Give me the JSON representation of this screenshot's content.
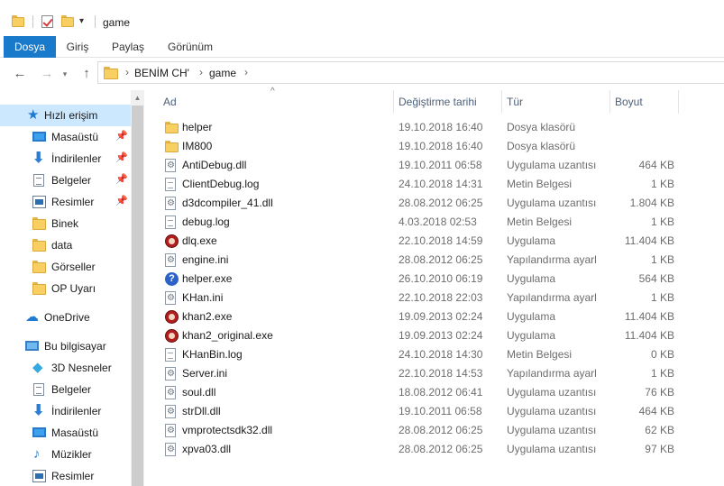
{
  "window": {
    "title": "game"
  },
  "quick_access_toolbar": {
    "icons": [
      "folder-icon",
      "properties-check-icon",
      "new-folder-icon",
      "customize-dropdown-icon"
    ]
  },
  "ribbon": {
    "tabs": [
      {
        "label": "Dosya",
        "active": true
      },
      {
        "label": "Giriş",
        "active": false
      },
      {
        "label": "Paylaş",
        "active": false
      },
      {
        "label": "Görünüm",
        "active": false
      }
    ],
    "accent_color": "#1979ca"
  },
  "address": {
    "path": [
      "BENİM CH'",
      "game"
    ]
  },
  "navigation": {
    "quick_access": {
      "label": "Hızlı erişim"
    },
    "pinned": [
      {
        "label": "Masaüstü"
      },
      {
        "label": "İndirilenler"
      },
      {
        "label": "Belgeler"
      },
      {
        "label": "Resimler"
      }
    ],
    "folders": [
      {
        "label": "Binek"
      },
      {
        "label": "data"
      },
      {
        "label": "Görseller"
      },
      {
        "label": "OP Uyarı"
      }
    ],
    "onedrive": {
      "label": "OneDrive"
    },
    "this_pc": {
      "label": "Bu bilgisayar"
    },
    "pc_items": [
      {
        "label": "3D Nesneler"
      },
      {
        "label": "Belgeler"
      },
      {
        "label": "İndirilenler"
      },
      {
        "label": "Masaüstü"
      },
      {
        "label": "Müzikler"
      },
      {
        "label": "Resimler"
      }
    ],
    "selection_color": "#cce8ff"
  },
  "file_list": {
    "columns": {
      "name": "Ad",
      "date": "Değiştirme tarihi",
      "type": "Tür",
      "size": "Boyut"
    },
    "rows": [
      {
        "name": "helper",
        "date": "19.10.2018 16:40",
        "type": "Dosya klasörü",
        "size": "",
        "icon": "folder"
      },
      {
        "name": "IM800",
        "date": "19.10.2018 16:40",
        "type": "Dosya klasörü",
        "size": "",
        "icon": "folder"
      },
      {
        "name": "AntiDebug.dll",
        "date": "19.10.2011 06:58",
        "type": "Uygulama uzantısı",
        "size": "464 KB",
        "icon": "gear"
      },
      {
        "name": "ClientDebug.log",
        "date": "24.10.2018 14:31",
        "type": "Metin Belgesi",
        "size": "1 KB",
        "icon": "file"
      },
      {
        "name": "d3dcompiler_41.dll",
        "date": "28.08.2012 06:25",
        "type": "Uygulama uzantısı",
        "size": "1.804 KB",
        "icon": "gear"
      },
      {
        "name": "debug.log",
        "date": "4.03.2018 02:53",
        "type": "Metin Belgesi",
        "size": "1 KB",
        "icon": "file"
      },
      {
        "name": "dlq.exe",
        "date": "22.10.2018 14:59",
        "type": "Uygulama",
        "size": "11.404 KB",
        "icon": "app"
      },
      {
        "name": "engine.ini",
        "date": "28.08.2012 06:25",
        "type": "Yapılandırma ayarl",
        "size": "1 KB",
        "icon": "gear"
      },
      {
        "name": "helper.exe",
        "date": "26.10.2010 06:19",
        "type": "Uygulama",
        "size": "564 KB",
        "icon": "help"
      },
      {
        "name": "KHan.ini",
        "date": "22.10.2018 22:03",
        "type": "Yapılandırma ayarl",
        "size": "1 KB",
        "icon": "gear"
      },
      {
        "name": "khan2.exe",
        "date": "19.09.2013 02:24",
        "type": "Uygulama",
        "size": "11.404 KB",
        "icon": "app"
      },
      {
        "name": "khan2_original.exe",
        "date": "19.09.2013 02:24",
        "type": "Uygulama",
        "size": "11.404 KB",
        "icon": "app"
      },
      {
        "name": "KHanBin.log",
        "date": "24.10.2018 14:30",
        "type": "Metin Belgesi",
        "size": "0 KB",
        "icon": "file"
      },
      {
        "name": "Server.ini",
        "date": "22.10.2018 14:53",
        "type": "Yapılandırma ayarl",
        "size": "1 KB",
        "icon": "gear"
      },
      {
        "name": "soul.dll",
        "date": "18.08.2012 06:41",
        "type": "Uygulama uzantısı",
        "size": "76 KB",
        "icon": "gear"
      },
      {
        "name": "strDll.dll",
        "date": "19.10.2011 06:58",
        "type": "Uygulama uzantısı",
        "size": "464 KB",
        "icon": "gear"
      },
      {
        "name": "vmprotectsdk32.dll",
        "date": "28.08.2012 06:25",
        "type": "Uygulama uzantısı",
        "size": "62 KB",
        "icon": "gear"
      },
      {
        "name": "xpva03.dll",
        "date": "28.08.2012 06:25",
        "type": "Uygulama uzantısı",
        "size": "97 KB",
        "icon": "gear"
      }
    ]
  }
}
